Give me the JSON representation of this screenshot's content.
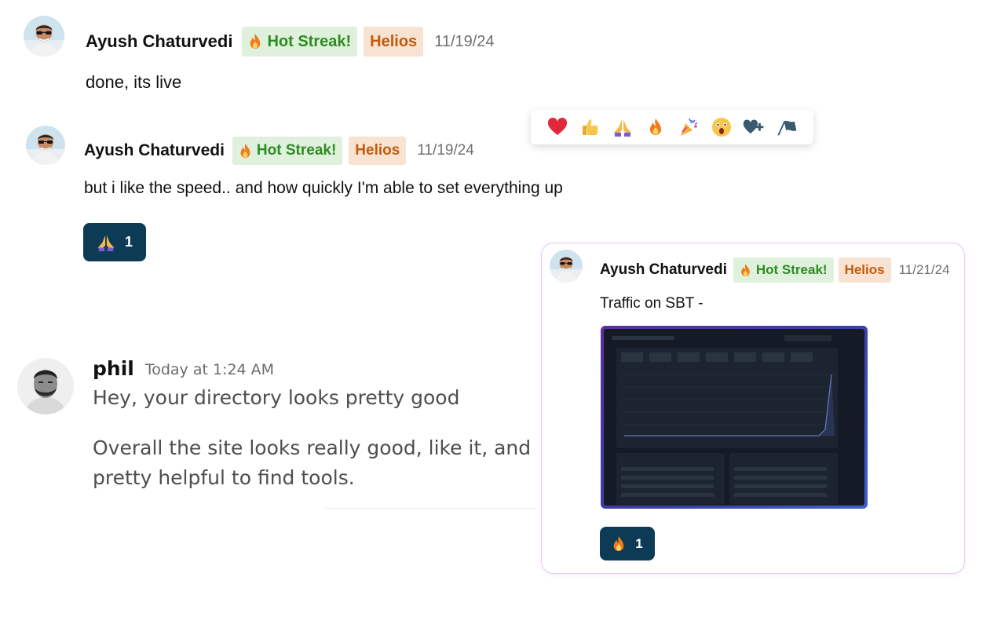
{
  "messages": [
    {
      "author": "Ayush Chaturvedi",
      "badge_streak": "Hot Streak!",
      "badge_helios": "Helios",
      "date": "11/19/24",
      "text": "done, its live"
    },
    {
      "author": "Ayush Chaturvedi",
      "badge_streak": "Hot Streak!",
      "badge_helios": "Helios",
      "date": "11/19/24",
      "text": "but i like the speed.. and how quickly I'm able to set everything up",
      "reaction": {
        "icon": "folded-hands-icon",
        "count": "1"
      }
    }
  ],
  "emoji_picker": {
    "items": [
      "red-heart-icon",
      "thumbs-up-icon",
      "folded-hands-icon",
      "fire-icon",
      "party-popper-icon",
      "astonished-face-icon",
      "add-reaction-icon",
      "follow-flag-icon"
    ]
  },
  "phil_message": {
    "author": "phil",
    "timestamp": "Today at 1:24 AM",
    "line1": "Hey, your directory looks pretty good",
    "line2": "Overall the site looks really good, like it, and",
    "line3": "pretty helpful to find tools."
  },
  "card": {
    "author": "Ayush Chaturvedi",
    "badge_streak": "Hot Streak!",
    "badge_helios": "Helios",
    "date": "11/21/24",
    "text": "Traffic on SBT -",
    "reaction": {
      "icon": "fire-icon",
      "count": "1"
    }
  },
  "colors": {
    "streak_bg": "#dff1dd",
    "streak_text": "#2e8b22",
    "helios_bg": "#f8e2d1",
    "helios_text": "#c25b0c",
    "reaction_bg": "#0d3b56",
    "card_border": "#e6c8ef"
  }
}
